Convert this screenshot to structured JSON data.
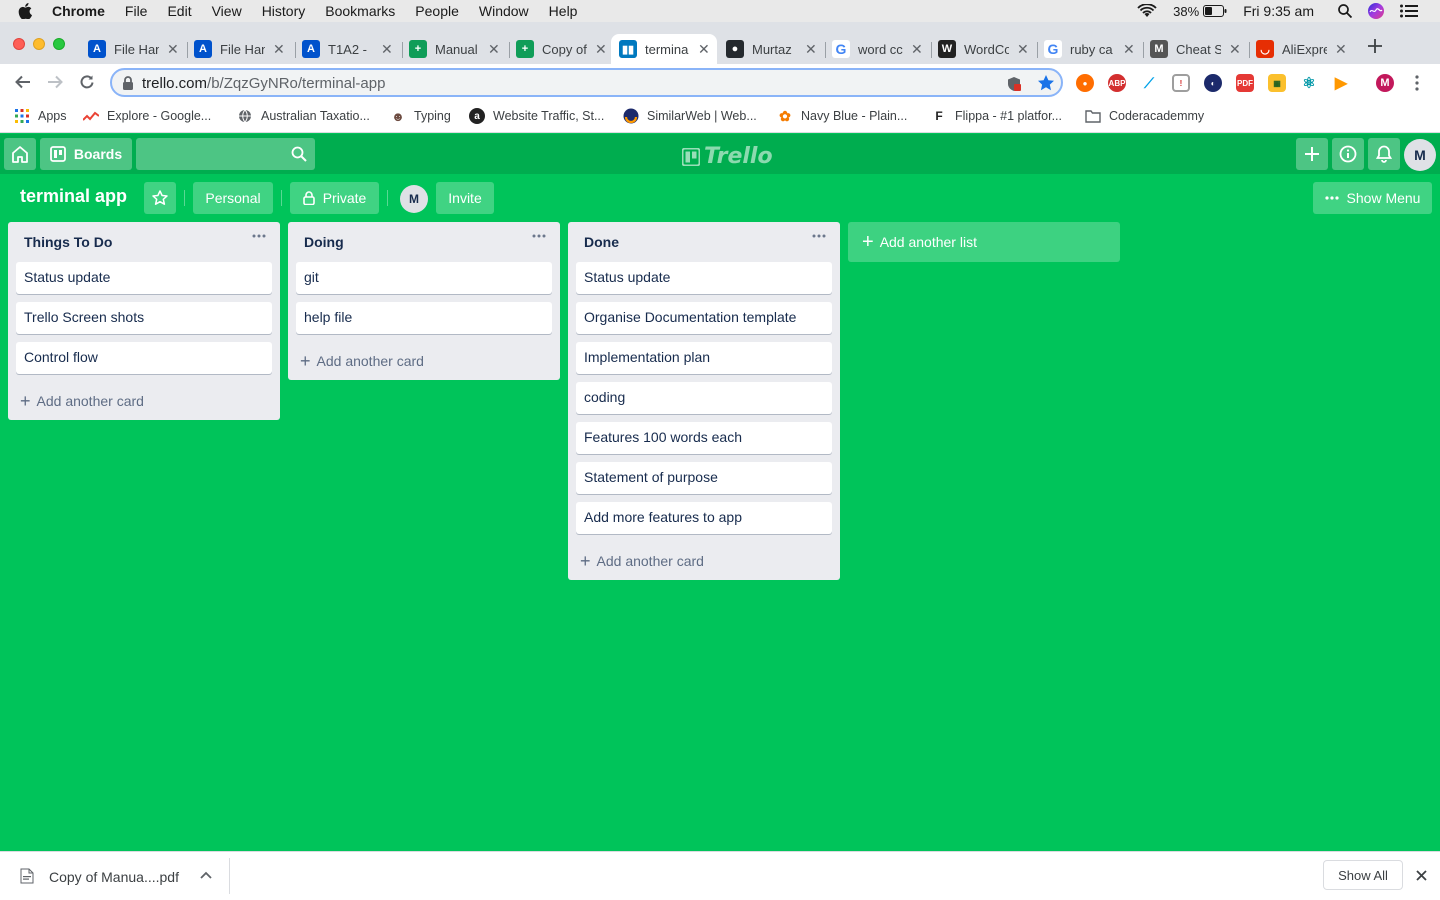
{
  "mac_menubar": {
    "app": "Chrome",
    "menus": [
      "File",
      "Edit",
      "View",
      "History",
      "Bookmarks",
      "People",
      "Window",
      "Help"
    ],
    "battery": "38%",
    "clock": "Fri 9:35 am"
  },
  "tabs": [
    {
      "label": "File Han",
      "icon": "atlassian-icon",
      "color": "#0052cc",
      "glyph": "A"
    },
    {
      "label": "File Han",
      "icon": "atlassian-icon",
      "color": "#0052cc",
      "glyph": "A"
    },
    {
      "label": "T1A2 -",
      "icon": "atlassian-icon",
      "color": "#0052cc",
      "glyph": "A"
    },
    {
      "label": "Manual",
      "icon": "sheets-icon",
      "color": "#0f9d58",
      "glyph": "+"
    },
    {
      "label": "Copy of",
      "icon": "sheets-icon",
      "color": "#0f9d58",
      "glyph": "+"
    },
    {
      "label": "termina",
      "icon": "trello-icon",
      "color": "#0079bf",
      "glyph": "▮▮",
      "active": true
    },
    {
      "label": "Murtaz",
      "icon": "github-icon",
      "color": "#24292e",
      "glyph": "●"
    },
    {
      "label": "word cc",
      "icon": "google-icon",
      "color": "#ffffff",
      "glyph": "G"
    },
    {
      "label": "WordCo",
      "icon": "wordcounter-icon",
      "color": "#222222",
      "glyph": "W"
    },
    {
      "label": "ruby ca",
      "icon": "google-icon",
      "color": "#ffffff",
      "glyph": "G"
    },
    {
      "label": "Cheat S",
      "icon": "cheatsheet-icon",
      "color": "#555555",
      "glyph": "M"
    },
    {
      "label": "AliExpre",
      "icon": "aliexpress-icon",
      "color": "#e62e04",
      "glyph": "◡"
    }
  ],
  "address_bar": {
    "domain": "trello.com",
    "path": "/b/ZqzGyNRo/terminal-app"
  },
  "bookmarks": [
    {
      "label": "Apps",
      "icon": "apps-grid-icon"
    },
    {
      "label": "Explore - Google...",
      "icon": "trends-icon"
    },
    {
      "label": "Australian Taxatio...",
      "icon": "globe-icon"
    },
    {
      "label": "Typing",
      "icon": "typing-icon"
    },
    {
      "label": "Website Traffic, St...",
      "icon": "alexa-icon"
    },
    {
      "label": "SimilarWeb | Web...",
      "icon": "similarweb-icon"
    },
    {
      "label": "Navy Blue - Plain...",
      "icon": "flower-icon"
    },
    {
      "label": "Flippa - #1 platfor...",
      "icon": "flippa-icon"
    },
    {
      "label": "Coderacademmy",
      "icon": "folder-icon"
    }
  ],
  "trello_header": {
    "boards_label": "Boards",
    "logo_text": "Trello",
    "avatar_initial": "M"
  },
  "board": {
    "title": "terminal app",
    "personal_label": "Personal",
    "private_label": "Private",
    "member_initial": "M",
    "invite_label": "Invite",
    "show_menu_label": "Show Menu",
    "add_list_label": "Add another list",
    "lists": [
      {
        "name": "Things To Do",
        "cards": [
          "Status update",
          "Trello Screen shots",
          "Control flow"
        ],
        "add_label": "Add another card"
      },
      {
        "name": "Doing",
        "cards": [
          "git",
          "help file"
        ],
        "add_label": "Add another card"
      },
      {
        "name": "Done",
        "cards": [
          "Status update",
          "Organise Documentation template",
          "Implementation plan",
          "coding",
          "Features 100 words each",
          "Statement of purpose",
          "Add more features to app"
        ],
        "add_label": "Add another card"
      }
    ]
  },
  "download_bar": {
    "filename": "Copy of Manua....pdf",
    "show_all_label": "Show All"
  },
  "colors": {
    "board_bg": "#00c45a",
    "header_bg": "#00ad4f",
    "list_bg": "#ebecf0"
  }
}
